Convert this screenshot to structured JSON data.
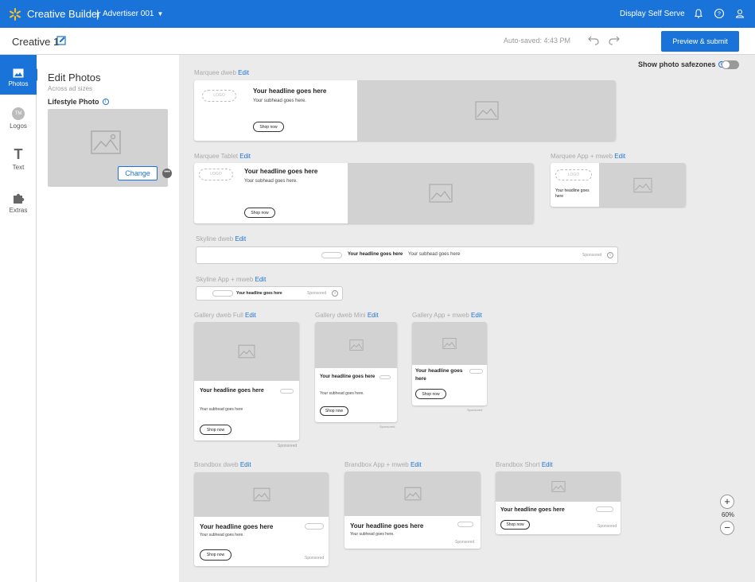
{
  "topbar": {
    "app_title": "Creative Builder",
    "separator": "|",
    "advertiser": "Advertiser 001",
    "display_self_serve": "Display Self Serve"
  },
  "secbar": {
    "creative_name": "Creative 1",
    "autosave": "Auto-saved: 4:43 PM",
    "preview_submit": "Preview & submit"
  },
  "rail": {
    "photos": "Photos",
    "logos": "Logos",
    "logos_badge": "TM",
    "text": "Text",
    "extras": "Extras"
  },
  "panel": {
    "title": "Edit Photos",
    "subtitle": "Across ad sizes",
    "label": "Lifestyle Photo",
    "change": "Change",
    "more": "•••"
  },
  "canvas": {
    "safezones": "Show photo safezones",
    "edit": "Edit",
    "headline": "Your headline goes here",
    "subhead": "Your subhead goes here.",
    "subhead_nodot": "Your subhead goes here",
    "shop_now": "Shop now",
    "sponsored": "Sponsored",
    "logo": "LOGO",
    "sections": {
      "marquee_dweb": "Marquee dweb",
      "marquee_tablet": "Marquee Tablet",
      "marquee_app": "Marquee App + mweb",
      "skyline_dweb": "Skyline dweb",
      "skyline_app": "Skyline App + mweb",
      "gallery_full": "Gallery dweb Full",
      "gallery_mini": "Gallery dweb Mini",
      "gallery_app": "Gallery App + mweb",
      "brandbox_dweb": "Brandbox dweb",
      "brandbox_app": "Brandbox App + mweb",
      "brandbox_short": "Brandbox Short"
    }
  },
  "zoom": {
    "plus": "+",
    "value": "60%",
    "minus": "−"
  },
  "colors": {
    "accent": "#1a73d9",
    "canvas_bg": "#ebebeb",
    "placeholder": "#d2d2d2"
  }
}
